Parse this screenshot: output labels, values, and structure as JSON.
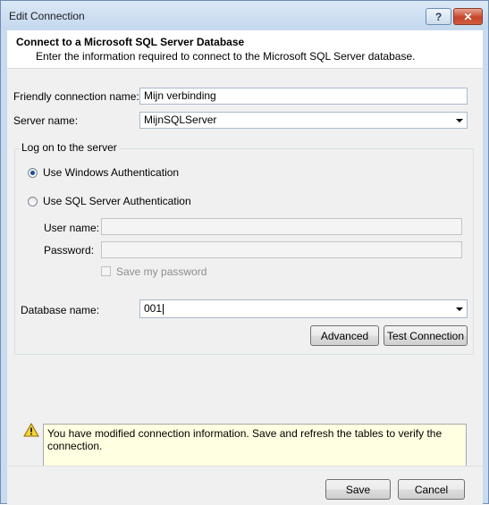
{
  "window": {
    "title": "Edit Connection",
    "help_label": "?",
    "close_label": "✕"
  },
  "header": {
    "title": "Connect to a Microsoft SQL Server Database",
    "subtitle": "Enter the information required to connect to the Microsoft SQL Server database."
  },
  "form": {
    "friendly_name_label": "Friendly connection name:",
    "friendly_name_value": "Mijn verbinding",
    "server_name_label": "Server name:",
    "server_name_value": "MijnSQLServer",
    "logon_group_label": "Log on to the server",
    "windows_auth_label": "Use Windows Authentication",
    "windows_auth_selected": true,
    "sql_auth_label": "Use SQL Server Authentication",
    "sql_auth_selected": false,
    "username_label": "User name:",
    "username_value": "",
    "password_label": "Password:",
    "password_value": "",
    "save_password_label": "Save my password",
    "save_password_checked": false,
    "database_name_label": "Database name:",
    "database_name_value": "001"
  },
  "buttons": {
    "advanced": "Advanced",
    "test_connection": "Test Connection",
    "save": "Save",
    "cancel": "Cancel"
  },
  "warning": {
    "icon": "warning-icon",
    "message": "You have modified connection information. Save and refresh the tables to verify the connection."
  },
  "colors": {
    "warning_background": "#ffffe1",
    "frame": "#c9dbee",
    "close_button": "#c5442a"
  }
}
